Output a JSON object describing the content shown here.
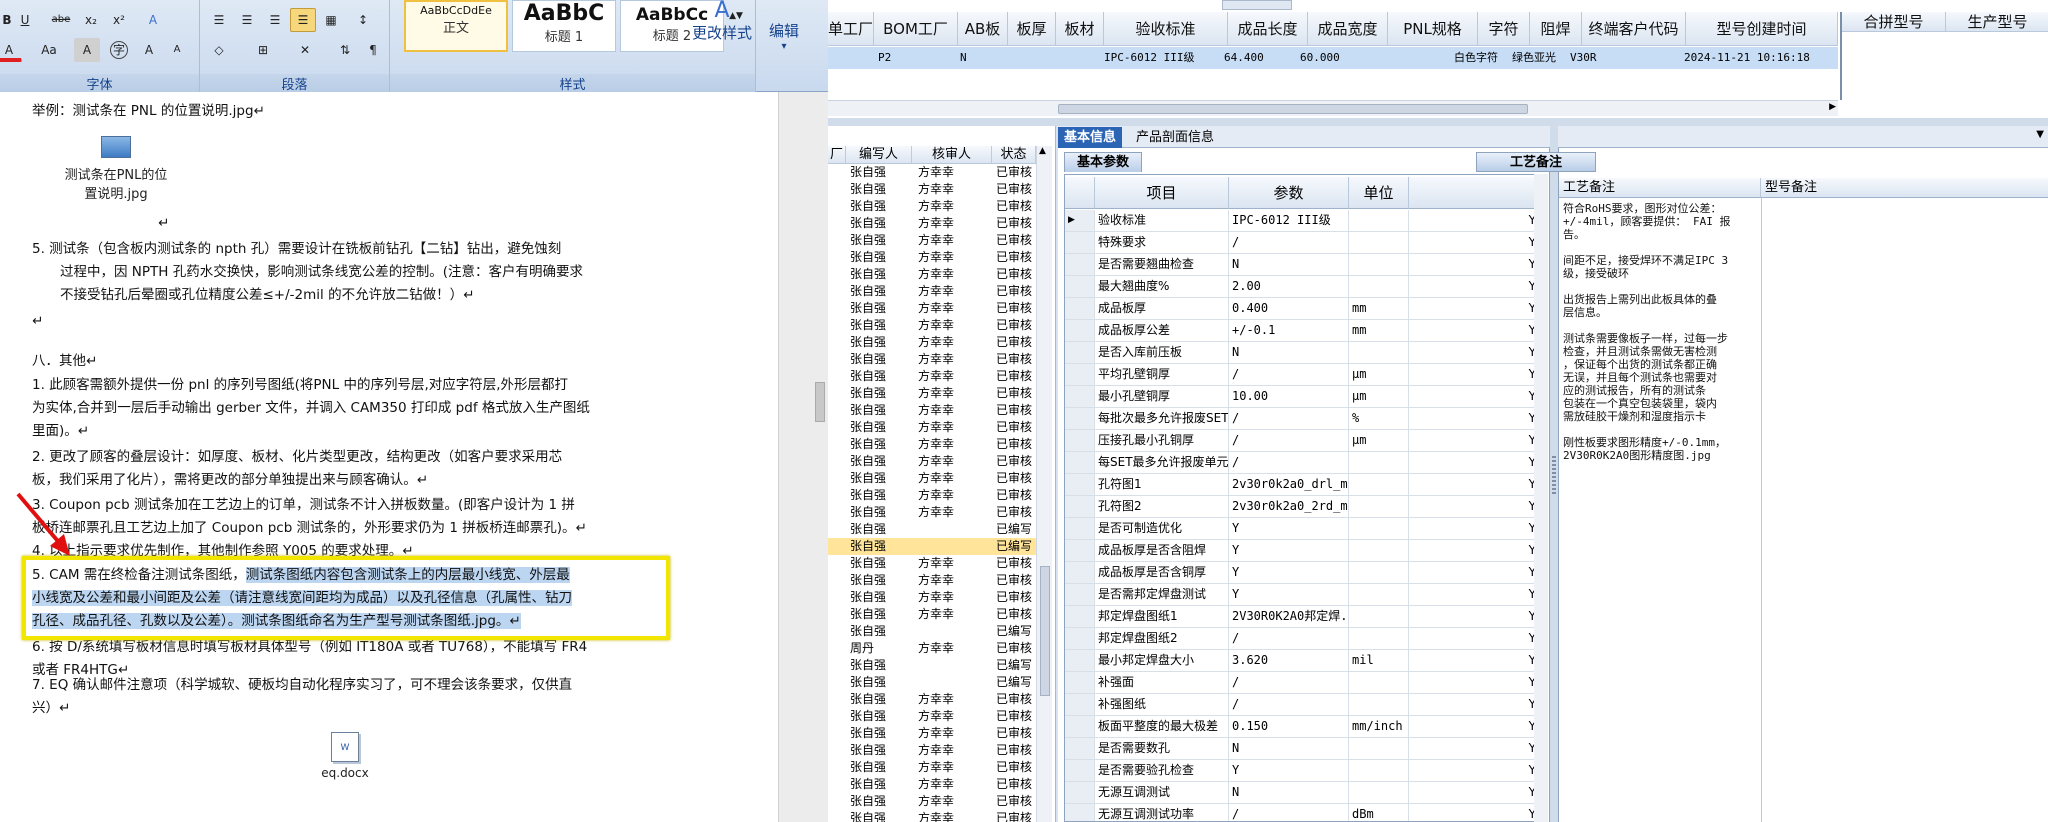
{
  "word": {
    "ribbon": {
      "font_group_label": "字体",
      "para_group_label": "段落",
      "style_group_label": "样式",
      "styles": [
        {
          "sample": "AaBbCcDdEe",
          "name": "正文"
        },
        {
          "sample": "AaBbC",
          "name": "标题 1"
        },
        {
          "sample": "AaBbCc",
          "name": "标题 2"
        }
      ],
      "change_styles_label": "更改样式",
      "edit_label": "编辑",
      "btn_bold": "B",
      "btn_underline": "U",
      "btn_strike": "abe",
      "btn_sub": "x₂",
      "btn_sup": "x²",
      "btn_clear": "A",
      "btn_font_color": "A",
      "btn_case": "Aa",
      "btn_char_border": "A",
      "btn_grow": "A",
      "btn_shrink": "A"
    },
    "doc": {
      "p1": "举例：测试条在 PNL 的位置说明.jpg↵",
      "embed1_label_line1": "测试条在PNL的位",
      "embed1_label_line2": "置说明.jpg",
      "p_blank1": "↵",
      "p5_line1": "5.  测试条（包含板内测试条的 npth 孔）需要设计在铣板前钻孔【二钻】钻出，避免蚀刻",
      "p5_line2": "过程中，因 NPTH 孔药水交换快，影响测试条线宽公差的控制。(注意：客户有明确要求",
      "p5_line3": "不接受钻孔后晕圈或孔位精度公差≤+/-2mil 的不允许放二钻做！）↵",
      "p_blank2": "↵",
      "s8_title": "八．其他↵",
      "s8_1_line1": "1.  此顾客需额外提供一份 pnl 的序列号图纸(将PNL 中的序列号层,对应字符层,外形层都打",
      "s8_1_line2": "为实体,合并到一层后手动输出 gerber 文件，并调入 CAM350 打印成 pdf 格式放入生产图纸",
      "s8_1_line3": "里面)。↵",
      "s8_2_line1": "2.  更改了顾客的叠层设计：如厚度、板材、化片类型更改，结构更改（如客户要求采用芯",
      "s8_2_line2": "板，我们采用了化片），需将更改的部分单独提出来与顾客确认。↵",
      "s8_3_line1": "3.  Coupon pcb 测试条加在工艺边上的订单，测试条不计入拼板数量。(即客户设计为 1 拼",
      "s8_3_line2": "板桥连邮票孔且工艺边上加了 Coupon pcb 测试条的，外形要求仍为 1 拼板桥连邮票孔)。↵",
      "s8_4": "4.  以上指示要求优先制作，其他制作参照 Y005 的要求处理。↵",
      "s8_5_pre": "5.  CAM 需在终检备注测试条图纸，",
      "s8_5_hl1": "测试条图纸内容包含测试条上的内层最小线宽、外层最",
      "s8_5_line2": "小线宽及公差和最小间距及公差（请注意线宽间距均为成品）以及孔径信息（孔属性、钻刀",
      "s8_5_line3": "孔径、成品孔径、孔数以及公差）。测试条图纸命名为生产型号测试条图纸.jpg。↵",
      "s8_6_line1": "6.  按 D/系统填写板材信息时填写板材具体型号（例如 IT180A 或者 TU768），不能填写 FR4",
      "s8_6_line2": "或者 FR4HTG↵",
      "s8_7_line1": "7. EQ 确认邮件注意项（科学城软、硬板均自动化程序实习了，可不理会该条要求，仅供直",
      "s8_7_line2": "兴）↵",
      "embed2_label": "eq.docx"
    }
  },
  "app": {
    "top_headers": [
      "单工厂",
      "BOM工厂",
      "AB板",
      "板厚",
      "板材",
      "验收标准",
      "成品长度",
      "成品宽度",
      "PNL规格",
      "字符",
      "阻焊",
      "终端客户代码",
      "型号创建时间"
    ],
    "top_row": {
      "bom": "P2",
      "ab": "N",
      "standard": "IPC-6012 III级",
      "length": "64.400",
      "width": "60.000",
      "char": "白色字符",
      "mask": "绿色亚光",
      "customer": "V30R",
      "created": "2024-11-21 10:16:18"
    },
    "right_headers": [
      "合拼型号",
      "生产型号"
    ],
    "list_headers": [
      "厂",
      "编写人",
      "核审人",
      "状态"
    ],
    "list_rows": [
      {
        "writer": "张自强",
        "reviewer": "方幸幸",
        "status": "已审核"
      },
      {
        "writer": "张自强",
        "reviewer": "方幸幸",
        "status": "已审核"
      },
      {
        "writer": "张自强",
        "reviewer": "方幸幸",
        "status": "已审核"
      },
      {
        "writer": "张自强",
        "reviewer": "方幸幸",
        "status": "已审核"
      },
      {
        "writer": "张自强",
        "reviewer": "方幸幸",
        "status": "已审核"
      },
      {
        "writer": "张自强",
        "reviewer": "方幸幸",
        "status": "已审核"
      },
      {
        "writer": "张自强",
        "reviewer": "方幸幸",
        "status": "已审核"
      },
      {
        "writer": "张自强",
        "reviewer": "方幸幸",
        "status": "已审核"
      },
      {
        "writer": "张自强",
        "reviewer": "方幸幸",
        "status": "已审核"
      },
      {
        "writer": "张自强",
        "reviewer": "方幸幸",
        "status": "已审核"
      },
      {
        "writer": "张自强",
        "reviewer": "方幸幸",
        "status": "已审核"
      },
      {
        "writer": "张自强",
        "reviewer": "方幸幸",
        "status": "已审核"
      },
      {
        "writer": "张自强",
        "reviewer": "方幸幸",
        "status": "已审核"
      },
      {
        "writer": "张自强",
        "reviewer": "方幸幸",
        "status": "已审核"
      },
      {
        "writer": "张自强",
        "reviewer": "方幸幸",
        "status": "已审核"
      },
      {
        "writer": "张自强",
        "reviewer": "方幸幸",
        "status": "已审核"
      },
      {
        "writer": "张自强",
        "reviewer": "方幸幸",
        "status": "已审核"
      },
      {
        "writer": "张自强",
        "reviewer": "方幸幸",
        "status": "已审核"
      },
      {
        "writer": "张自强",
        "reviewer": "方幸幸",
        "status": "已审核"
      },
      {
        "writer": "张自强",
        "reviewer": "方幸幸",
        "status": "已审核"
      },
      {
        "writer": "张自强",
        "reviewer": "方幸幸",
        "status": "已审核"
      },
      {
        "writer": "张自强",
        "reviewer": "",
        "status": "已编写"
      },
      {
        "writer": "张自强",
        "reviewer": "",
        "status": "已编写"
      },
      {
        "writer": "张自强",
        "reviewer": "方幸幸",
        "status": "已审核"
      },
      {
        "writer": "张自强",
        "reviewer": "方幸幸",
        "status": "已审核"
      },
      {
        "writer": "张自强",
        "reviewer": "方幸幸",
        "status": "已审核"
      },
      {
        "writer": "张自强",
        "reviewer": "方幸幸",
        "status": "已审核"
      },
      {
        "writer": "张自强",
        "reviewer": "",
        "status": "已编写"
      },
      {
        "writer": "周丹",
        "reviewer": "方幸幸",
        "status": "已审核"
      },
      {
        "writer": "张自强",
        "reviewer": "",
        "status": "已编写"
      },
      {
        "writer": "张自强",
        "reviewer": "",
        "status": "已编写"
      },
      {
        "writer": "张自强",
        "reviewer": "方幸幸",
        "status": "已审核"
      },
      {
        "writer": "张自强",
        "reviewer": "方幸幸",
        "status": "已审核"
      },
      {
        "writer": "张自强",
        "reviewer": "方幸幸",
        "status": "已审核"
      },
      {
        "writer": "张自强",
        "reviewer": "方幸幸",
        "status": "已审核"
      },
      {
        "writer": "张自强",
        "reviewer": "方幸幸",
        "status": "已审核"
      },
      {
        "writer": "张自强",
        "reviewer": "方幸幸",
        "status": "已审核"
      },
      {
        "writer": "张自强",
        "reviewer": "方幸幸",
        "status": "已审核"
      },
      {
        "writer": "张自强",
        "reviewer": "方幸幸",
        "status": "已审核"
      },
      {
        "writer": "张自强",
        "reviewer": "方幸幸",
        "status": "已审核"
      }
    ],
    "list_selected_index": 22,
    "tabs": [
      "基本信息",
      "产品剖面信息"
    ],
    "subtab": "基本参数",
    "param_headers": [
      "项目",
      "参数",
      "单位"
    ],
    "params": [
      {
        "item": "验收标准",
        "value": "IPC-6012 III级",
        "unit": "",
        "flag": "Y"
      },
      {
        "item": "特殊要求",
        "value": "/",
        "unit": "",
        "flag": "Y"
      },
      {
        "item": "是否需要翘曲检查",
        "value": "N",
        "unit": "",
        "flag": "Y"
      },
      {
        "item": "最大翘曲度%",
        "value": "2.00",
        "unit": "",
        "flag": "Y"
      },
      {
        "item": "成品板厚",
        "value": "0.400",
        "unit": "mm",
        "flag": "Y"
      },
      {
        "item": "成品板厚公差",
        "value": "+/-0.1",
        "unit": "mm",
        "flag": "Y"
      },
      {
        "item": "是否入库前压板",
        "value": "N",
        "unit": "",
        "flag": "Y"
      },
      {
        "item": "平均孔壁铜厚",
        "value": "/",
        "unit": "μm",
        "flag": "Y"
      },
      {
        "item": "最小孔壁铜厚",
        "value": "10.00",
        "unit": "μm",
        "flag": "Y"
      },
      {
        "item": "每批次最多允许报废SET",
        "value": "/",
        "unit": "%",
        "flag": "Y"
      },
      {
        "item": "压接孔最小孔铜厚",
        "value": "/",
        "unit": "μm",
        "flag": "Y"
      },
      {
        "item": "每SET最多允许报废单元",
        "value": "/",
        "unit": "",
        "flag": "Y"
      },
      {
        "item": "孔符图1",
        "value": "2v30r0k2a0_drl_m...",
        "unit": "",
        "flag": "Y"
      },
      {
        "item": "孔符图2",
        "value": "2v30r0k2a0_2rd_m...",
        "unit": "",
        "flag": "Y"
      },
      {
        "item": "是否可制造优化",
        "value": "Y",
        "unit": "",
        "flag": "Y"
      },
      {
        "item": "成品板厚是否含阻焊",
        "value": "Y",
        "unit": "",
        "flag": "Y"
      },
      {
        "item": "成品板厚是否含铜厚",
        "value": "Y",
        "unit": "",
        "flag": "Y"
      },
      {
        "item": "是否需邦定焊盘测试",
        "value": "Y",
        "unit": "",
        "flag": "Y"
      },
      {
        "item": "邦定焊盘图纸1",
        "value": "2V30R0K2A0邦定焊...",
        "unit": "",
        "flag": "Y"
      },
      {
        "item": "邦定焊盘图纸2",
        "value": "/",
        "unit": "",
        "flag": "Y"
      },
      {
        "item": "最小邦定焊盘大小",
        "value": "3.620",
        "unit": "mil",
        "flag": "Y"
      },
      {
        "item": "补强面",
        "value": "/",
        "unit": "",
        "flag": "Y"
      },
      {
        "item": "补强图纸",
        "value": "/",
        "unit": "",
        "flag": "Y"
      },
      {
        "item": "板面平整度的最大极差",
        "value": "0.150",
        "unit": "mm/inch",
        "flag": "Y"
      },
      {
        "item": "是否需要数孔",
        "value": "N",
        "unit": "",
        "flag": "Y"
      },
      {
        "item": "是否需要验孔检查",
        "value": "Y",
        "unit": "",
        "flag": "Y"
      },
      {
        "item": "无源互调测试",
        "value": "N",
        "unit": "",
        "flag": "Y"
      },
      {
        "item": "无源互调测试功率",
        "value": "/",
        "unit": "dBm",
        "flag": "Y"
      }
    ],
    "notes_tab": "工艺备注",
    "notes_headers": [
      "工艺备注",
      "型号备注"
    ],
    "notes_text": "符合RoHS要求，图形对位公差：\n+/-4mil，顾客要提供： FAI 报\n告。\n\n间距不足，接受焊环不满足IPC 3\n级，接受破环\n\n出货报告上需列出此板具体的叠\n层信息。\n\n测试条需要像板子一样，过每一步\n检查，并且测试条需做无害检测\n，保证每个出货的测试条都正确\n无误，并且每个测试条也需要对\n应的测试报告，所有的测试条\n包装在一个真空包装袋里，袋内\n需放硅胶干燥剂和湿度指示卡\n\n刚性板要求图形精度+/-0.1mm，\n2V30R0K2A0图形精度图.jpg"
  }
}
